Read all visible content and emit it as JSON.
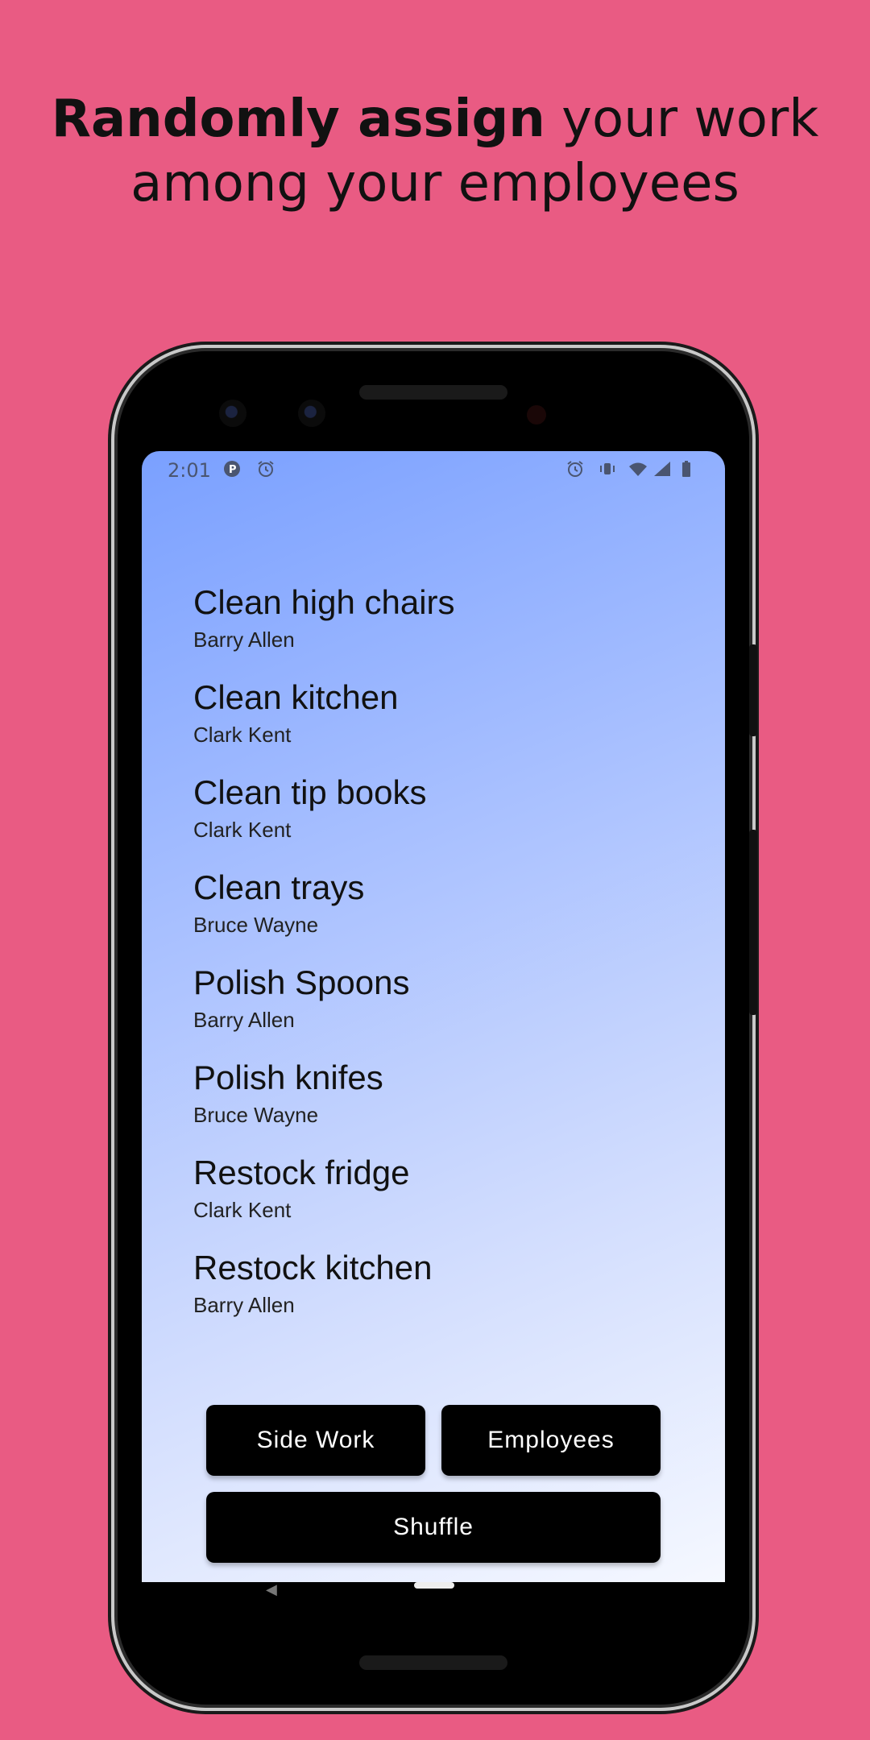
{
  "headline": {
    "bold": "Randomly assign",
    "rest_line1": " your work",
    "line2": "among your employees"
  },
  "status_bar": {
    "time": "2:01",
    "left_icons": [
      "p-circle-icon",
      "alarm-icon"
    ],
    "right_icons": [
      "alarm-icon",
      "vibrate-icon",
      "wifi-icon",
      "signal-icon",
      "battery-icon"
    ]
  },
  "work_list": [
    {
      "task": "Clean high chairs",
      "employee": "Barry Allen"
    },
    {
      "task": "Clean kitchen",
      "employee": "Clark Kent"
    },
    {
      "task": "Clean tip books",
      "employee": "Clark Kent"
    },
    {
      "task": "Clean trays",
      "employee": "Bruce Wayne"
    },
    {
      "task": "Polish Spoons",
      "employee": "Barry Allen"
    },
    {
      "task": "Polish knifes",
      "employee": "Bruce Wayne"
    },
    {
      "task": "Restock fridge",
      "employee": "Clark Kent"
    },
    {
      "task": "Restock kitchen",
      "employee": "Barry Allen"
    }
  ],
  "buttons": {
    "side_work": "Side Work",
    "employees": "Employees",
    "shuffle": "Shuffle"
  },
  "colors": {
    "background": "#e95b83",
    "gradient_top": "#7aa0ff",
    "gradient_bottom": "#f5f8ff",
    "button": "#000000"
  }
}
